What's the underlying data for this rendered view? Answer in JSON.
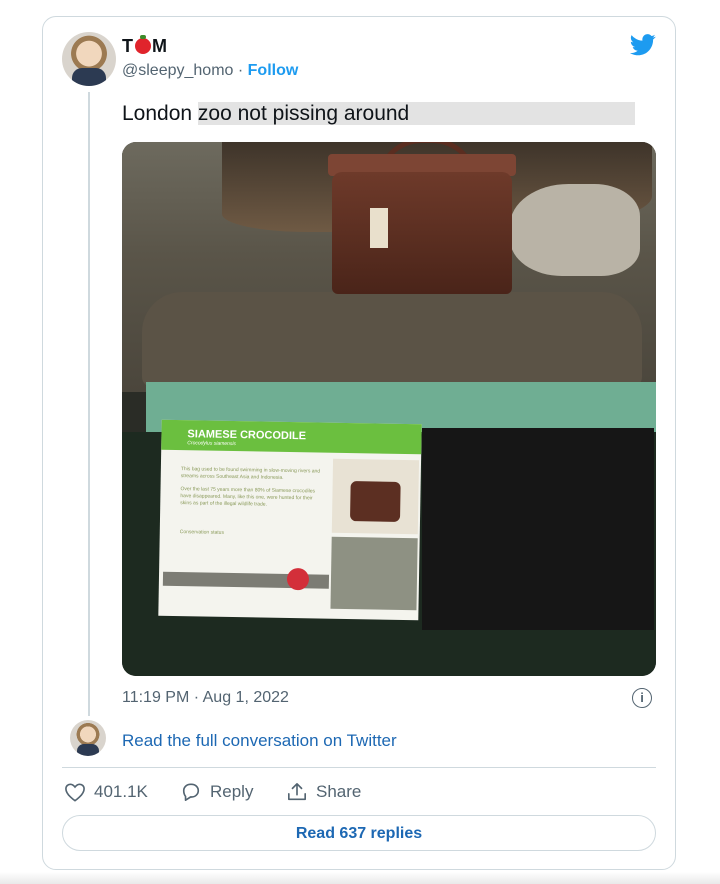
{
  "author": {
    "name_prefix": "T",
    "name_suffix": "M",
    "handle": "@sleepy_homo",
    "separator": " · ",
    "follow_label": "Follow"
  },
  "tweet": {
    "text_plain": "London ",
    "text_highlight": "zoo not pissing around",
    "timestamp": "11:19 PM · Aug 1, 2022"
  },
  "sign": {
    "title": "SIAMESE CROCODILE",
    "subtitle": "Crocodylus siamensis",
    "paragraph1": "This bag used to be found swimming in slow-moving rivers and streams across Southeast Asia and Indonesia.",
    "paragraph2": "Over the last 75 years more than 80% of Siamese crocodiles have disappeared. Many, like this one, were hunted for their skins as part of the illegal wildlife trade.",
    "status_label": "Conservation status"
  },
  "conversation_link": "Read the full conversation on Twitter",
  "actions": {
    "likes": "401.1K",
    "reply": "Reply",
    "share": "Share"
  },
  "read_replies": "Read 637 replies",
  "colors": {
    "accent": "#1d9bf0",
    "link": "#1d68b3",
    "muted": "#536471"
  }
}
